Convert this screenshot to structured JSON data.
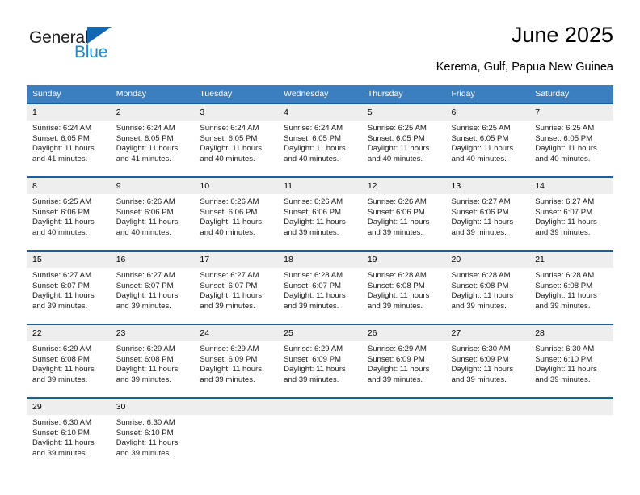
{
  "brand": {
    "line1": "General",
    "line2": "Blue",
    "flag_icon": "triangle-flag-icon",
    "accent_dark": "#1268b3",
    "accent_light": "#1b8bd0"
  },
  "header": {
    "title": "June 2025",
    "location": "Kerema, Gulf, Papua New Guinea"
  },
  "colors": {
    "header_blue": "#3c7fc1",
    "cell_border_blue": "#15619e",
    "daynum_gray": "#eeeeee"
  },
  "weekday_headers": [
    "Sunday",
    "Monday",
    "Tuesday",
    "Wednesday",
    "Thursday",
    "Friday",
    "Saturday"
  ],
  "weeks": [
    [
      {
        "day": "1",
        "sunrise": "Sunrise: 6:24 AM",
        "sunset": "Sunset: 6:05 PM",
        "daylight1": "Daylight: 11 hours",
        "daylight2": "and 41 minutes."
      },
      {
        "day": "2",
        "sunrise": "Sunrise: 6:24 AM",
        "sunset": "Sunset: 6:05 PM",
        "daylight1": "Daylight: 11 hours",
        "daylight2": "and 41 minutes."
      },
      {
        "day": "3",
        "sunrise": "Sunrise: 6:24 AM",
        "sunset": "Sunset: 6:05 PM",
        "daylight1": "Daylight: 11 hours",
        "daylight2": "and 40 minutes."
      },
      {
        "day": "4",
        "sunrise": "Sunrise: 6:24 AM",
        "sunset": "Sunset: 6:05 PM",
        "daylight1": "Daylight: 11 hours",
        "daylight2": "and 40 minutes."
      },
      {
        "day": "5",
        "sunrise": "Sunrise: 6:25 AM",
        "sunset": "Sunset: 6:05 PM",
        "daylight1": "Daylight: 11 hours",
        "daylight2": "and 40 minutes."
      },
      {
        "day": "6",
        "sunrise": "Sunrise: 6:25 AM",
        "sunset": "Sunset: 6:05 PM",
        "daylight1": "Daylight: 11 hours",
        "daylight2": "and 40 minutes."
      },
      {
        "day": "7",
        "sunrise": "Sunrise: 6:25 AM",
        "sunset": "Sunset: 6:05 PM",
        "daylight1": "Daylight: 11 hours",
        "daylight2": "and 40 minutes."
      }
    ],
    [
      {
        "day": "8",
        "sunrise": "Sunrise: 6:25 AM",
        "sunset": "Sunset: 6:06 PM",
        "daylight1": "Daylight: 11 hours",
        "daylight2": "and 40 minutes."
      },
      {
        "day": "9",
        "sunrise": "Sunrise: 6:26 AM",
        "sunset": "Sunset: 6:06 PM",
        "daylight1": "Daylight: 11 hours",
        "daylight2": "and 40 minutes."
      },
      {
        "day": "10",
        "sunrise": "Sunrise: 6:26 AM",
        "sunset": "Sunset: 6:06 PM",
        "daylight1": "Daylight: 11 hours",
        "daylight2": "and 40 minutes."
      },
      {
        "day": "11",
        "sunrise": "Sunrise: 6:26 AM",
        "sunset": "Sunset: 6:06 PM",
        "daylight1": "Daylight: 11 hours",
        "daylight2": "and 39 minutes."
      },
      {
        "day": "12",
        "sunrise": "Sunrise: 6:26 AM",
        "sunset": "Sunset: 6:06 PM",
        "daylight1": "Daylight: 11 hours",
        "daylight2": "and 39 minutes."
      },
      {
        "day": "13",
        "sunrise": "Sunrise: 6:27 AM",
        "sunset": "Sunset: 6:06 PM",
        "daylight1": "Daylight: 11 hours",
        "daylight2": "and 39 minutes."
      },
      {
        "day": "14",
        "sunrise": "Sunrise: 6:27 AM",
        "sunset": "Sunset: 6:07 PM",
        "daylight1": "Daylight: 11 hours",
        "daylight2": "and 39 minutes."
      }
    ],
    [
      {
        "day": "15",
        "sunrise": "Sunrise: 6:27 AM",
        "sunset": "Sunset: 6:07 PM",
        "daylight1": "Daylight: 11 hours",
        "daylight2": "and 39 minutes."
      },
      {
        "day": "16",
        "sunrise": "Sunrise: 6:27 AM",
        "sunset": "Sunset: 6:07 PM",
        "daylight1": "Daylight: 11 hours",
        "daylight2": "and 39 minutes."
      },
      {
        "day": "17",
        "sunrise": "Sunrise: 6:27 AM",
        "sunset": "Sunset: 6:07 PM",
        "daylight1": "Daylight: 11 hours",
        "daylight2": "and 39 minutes."
      },
      {
        "day": "18",
        "sunrise": "Sunrise: 6:28 AM",
        "sunset": "Sunset: 6:07 PM",
        "daylight1": "Daylight: 11 hours",
        "daylight2": "and 39 minutes."
      },
      {
        "day": "19",
        "sunrise": "Sunrise: 6:28 AM",
        "sunset": "Sunset: 6:08 PM",
        "daylight1": "Daylight: 11 hours",
        "daylight2": "and 39 minutes."
      },
      {
        "day": "20",
        "sunrise": "Sunrise: 6:28 AM",
        "sunset": "Sunset: 6:08 PM",
        "daylight1": "Daylight: 11 hours",
        "daylight2": "and 39 minutes."
      },
      {
        "day": "21",
        "sunrise": "Sunrise: 6:28 AM",
        "sunset": "Sunset: 6:08 PM",
        "daylight1": "Daylight: 11 hours",
        "daylight2": "and 39 minutes."
      }
    ],
    [
      {
        "day": "22",
        "sunrise": "Sunrise: 6:29 AM",
        "sunset": "Sunset: 6:08 PM",
        "daylight1": "Daylight: 11 hours",
        "daylight2": "and 39 minutes."
      },
      {
        "day": "23",
        "sunrise": "Sunrise: 6:29 AM",
        "sunset": "Sunset: 6:08 PM",
        "daylight1": "Daylight: 11 hours",
        "daylight2": "and 39 minutes."
      },
      {
        "day": "24",
        "sunrise": "Sunrise: 6:29 AM",
        "sunset": "Sunset: 6:09 PM",
        "daylight1": "Daylight: 11 hours",
        "daylight2": "and 39 minutes."
      },
      {
        "day": "25",
        "sunrise": "Sunrise: 6:29 AM",
        "sunset": "Sunset: 6:09 PM",
        "daylight1": "Daylight: 11 hours",
        "daylight2": "and 39 minutes."
      },
      {
        "day": "26",
        "sunrise": "Sunrise: 6:29 AM",
        "sunset": "Sunset: 6:09 PM",
        "daylight1": "Daylight: 11 hours",
        "daylight2": "and 39 minutes."
      },
      {
        "day": "27",
        "sunrise": "Sunrise: 6:30 AM",
        "sunset": "Sunset: 6:09 PM",
        "daylight1": "Daylight: 11 hours",
        "daylight2": "and 39 minutes."
      },
      {
        "day": "28",
        "sunrise": "Sunrise: 6:30 AM",
        "sunset": "Sunset: 6:10 PM",
        "daylight1": "Daylight: 11 hours",
        "daylight2": "and 39 minutes."
      }
    ],
    [
      {
        "day": "29",
        "sunrise": "Sunrise: 6:30 AM",
        "sunset": "Sunset: 6:10 PM",
        "daylight1": "Daylight: 11 hours",
        "daylight2": "and 39 minutes."
      },
      {
        "day": "30",
        "sunrise": "Sunrise: 6:30 AM",
        "sunset": "Sunset: 6:10 PM",
        "daylight1": "Daylight: 11 hours",
        "daylight2": "and 39 minutes."
      },
      {
        "day": "",
        "sunrise": "",
        "sunset": "",
        "daylight1": "",
        "daylight2": ""
      },
      {
        "day": "",
        "sunrise": "",
        "sunset": "",
        "daylight1": "",
        "daylight2": ""
      },
      {
        "day": "",
        "sunrise": "",
        "sunset": "",
        "daylight1": "",
        "daylight2": ""
      },
      {
        "day": "",
        "sunrise": "",
        "sunset": "",
        "daylight1": "",
        "daylight2": ""
      },
      {
        "day": "",
        "sunrise": "",
        "sunset": "",
        "daylight1": "",
        "daylight2": ""
      }
    ]
  ]
}
